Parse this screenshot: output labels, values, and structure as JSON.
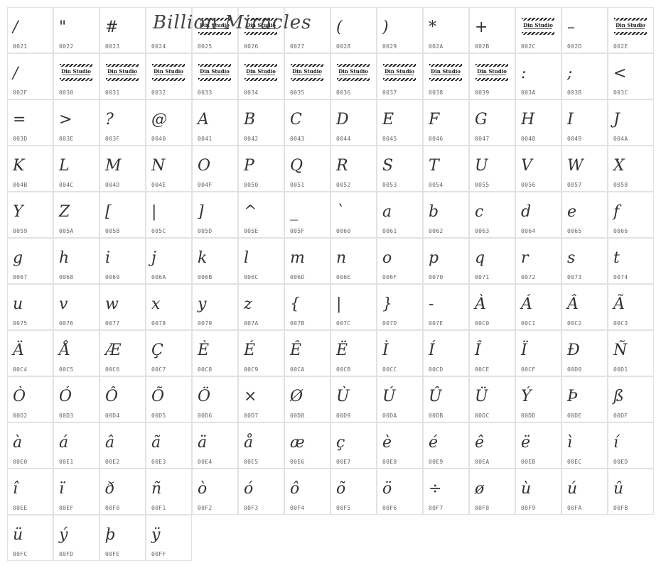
{
  "title": "Billion Miracles",
  "stamp_label": "Din Studio",
  "glyphs": [
    {
      "code": "0021",
      "char": "/"
    },
    {
      "code": "0022",
      "char": "\""
    },
    {
      "code": "0023",
      "char": "#"
    },
    {
      "code": "0024",
      "char": ""
    },
    {
      "code": "0025",
      "char": "",
      "stamp": true
    },
    {
      "code": "0026",
      "char": "",
      "stamp": true
    },
    {
      "code": "0027",
      "char": "'"
    },
    {
      "code": "0028",
      "char": "("
    },
    {
      "code": "0029",
      "char": ")"
    },
    {
      "code": "002A",
      "char": "*"
    },
    {
      "code": "002B",
      "char": "+"
    },
    {
      "code": "002C",
      "char": "",
      "stamp": true
    },
    {
      "code": "002D",
      "char": "–"
    },
    {
      "code": "002E",
      "char": "",
      "stamp": true
    },
    {
      "code": "002F",
      "char": "/"
    },
    {
      "code": "0030",
      "char": "",
      "stamp": true
    },
    {
      "code": "0031",
      "char": "",
      "stamp": true
    },
    {
      "code": "0032",
      "char": "",
      "stamp": true
    },
    {
      "code": "0033",
      "char": "",
      "stamp": true
    },
    {
      "code": "0034",
      "char": "",
      "stamp": true
    },
    {
      "code": "0035",
      "char": "",
      "stamp": true
    },
    {
      "code": "0036",
      "char": "",
      "stamp": true
    },
    {
      "code": "0037",
      "char": "",
      "stamp": true
    },
    {
      "code": "0038",
      "char": "",
      "stamp": true
    },
    {
      "code": "0039",
      "char": "",
      "stamp": true
    },
    {
      "code": "003A",
      "char": ":"
    },
    {
      "code": "003B",
      "char": ";"
    },
    {
      "code": "003C",
      "char": "<"
    },
    {
      "code": "003D",
      "char": "="
    },
    {
      "code": "003E",
      "char": ">"
    },
    {
      "code": "003F",
      "char": "?"
    },
    {
      "code": "0040",
      "char": "@"
    },
    {
      "code": "0041",
      "char": "A"
    },
    {
      "code": "0042",
      "char": "B"
    },
    {
      "code": "0043",
      "char": "C"
    },
    {
      "code": "0044",
      "char": "D"
    },
    {
      "code": "0045",
      "char": "E"
    },
    {
      "code": "0046",
      "char": "F"
    },
    {
      "code": "0047",
      "char": "G"
    },
    {
      "code": "0048",
      "char": "H"
    },
    {
      "code": "0049",
      "char": "I"
    },
    {
      "code": "004A",
      "char": "J"
    },
    {
      "code": "004B",
      "char": "K"
    },
    {
      "code": "004C",
      "char": "L"
    },
    {
      "code": "004D",
      "char": "M"
    },
    {
      "code": "004E",
      "char": "N"
    },
    {
      "code": "004F",
      "char": "O"
    },
    {
      "code": "0050",
      "char": "P"
    },
    {
      "code": "0051",
      "char": "Q"
    },
    {
      "code": "0052",
      "char": "R"
    },
    {
      "code": "0053",
      "char": "S"
    },
    {
      "code": "0054",
      "char": "T"
    },
    {
      "code": "0055",
      "char": "U"
    },
    {
      "code": "0056",
      "char": "V"
    },
    {
      "code": "0057",
      "char": "W"
    },
    {
      "code": "0058",
      "char": "X"
    },
    {
      "code": "0059",
      "char": "Y"
    },
    {
      "code": "005A",
      "char": "Z"
    },
    {
      "code": "005B",
      "char": "["
    },
    {
      "code": "005C",
      "char": "|"
    },
    {
      "code": "005D",
      "char": "]"
    },
    {
      "code": "005E",
      "char": "^"
    },
    {
      "code": "005F",
      "char": "_"
    },
    {
      "code": "0060",
      "char": "`"
    },
    {
      "code": "0061",
      "char": "a"
    },
    {
      "code": "0062",
      "char": "b"
    },
    {
      "code": "0063",
      "char": "c"
    },
    {
      "code": "0064",
      "char": "d"
    },
    {
      "code": "0065",
      "char": "e"
    },
    {
      "code": "0066",
      "char": "f"
    },
    {
      "code": "0067",
      "char": "g"
    },
    {
      "code": "0068",
      "char": "h"
    },
    {
      "code": "0069",
      "char": "i"
    },
    {
      "code": "006A",
      "char": "j"
    },
    {
      "code": "006B",
      "char": "k"
    },
    {
      "code": "006C",
      "char": "l"
    },
    {
      "code": "006D",
      "char": "m"
    },
    {
      "code": "006E",
      "char": "n"
    },
    {
      "code": "006F",
      "char": "o"
    },
    {
      "code": "0070",
      "char": "p"
    },
    {
      "code": "0071",
      "char": "q"
    },
    {
      "code": "0072",
      "char": "r"
    },
    {
      "code": "0073",
      "char": "s"
    },
    {
      "code": "0074",
      "char": "t"
    },
    {
      "code": "0075",
      "char": "u"
    },
    {
      "code": "0076",
      "char": "v"
    },
    {
      "code": "0077",
      "char": "w"
    },
    {
      "code": "0078",
      "char": "x"
    },
    {
      "code": "0079",
      "char": "y"
    },
    {
      "code": "007A",
      "char": "z"
    },
    {
      "code": "007B",
      "char": "{"
    },
    {
      "code": "007C",
      "char": "|"
    },
    {
      "code": "007D",
      "char": "}"
    },
    {
      "code": "007E",
      "char": "-"
    },
    {
      "code": "00C0",
      "char": "À"
    },
    {
      "code": "00C1",
      "char": "Á"
    },
    {
      "code": "00C2",
      "char": "Â"
    },
    {
      "code": "00C3",
      "char": "Ã"
    },
    {
      "code": "00C4",
      "char": "Ä"
    },
    {
      "code": "00C5",
      "char": "Å"
    },
    {
      "code": "00C6",
      "char": "Æ"
    },
    {
      "code": "00C7",
      "char": "Ç"
    },
    {
      "code": "00C8",
      "char": "È"
    },
    {
      "code": "00C9",
      "char": "É"
    },
    {
      "code": "00CA",
      "char": "Ê"
    },
    {
      "code": "00CB",
      "char": "Ë"
    },
    {
      "code": "00CC",
      "char": "Ì"
    },
    {
      "code": "00CD",
      "char": "Í"
    },
    {
      "code": "00CE",
      "char": "Î"
    },
    {
      "code": "00CF",
      "char": "Ï"
    },
    {
      "code": "00D0",
      "char": "Ð"
    },
    {
      "code": "00D1",
      "char": "Ñ"
    },
    {
      "code": "00D2",
      "char": "Ò"
    },
    {
      "code": "00D3",
      "char": "Ó"
    },
    {
      "code": "00D4",
      "char": "Ô"
    },
    {
      "code": "00D5",
      "char": "Õ"
    },
    {
      "code": "00D6",
      "char": "Ö"
    },
    {
      "code": "00D7",
      "char": "×"
    },
    {
      "code": "00D8",
      "char": "Ø"
    },
    {
      "code": "00D9",
      "char": "Ù"
    },
    {
      "code": "00DA",
      "char": "Ú"
    },
    {
      "code": "00DB",
      "char": "Û"
    },
    {
      "code": "00DC",
      "char": "Ü"
    },
    {
      "code": "00DD",
      "char": "Ý"
    },
    {
      "code": "00DE",
      "char": "Þ"
    },
    {
      "code": "00DF",
      "char": "ß"
    },
    {
      "code": "00E0",
      "char": "à"
    },
    {
      "code": "00E1",
      "char": "á"
    },
    {
      "code": "00E2",
      "char": "â"
    },
    {
      "code": "00E3",
      "char": "ã"
    },
    {
      "code": "00E4",
      "char": "ä"
    },
    {
      "code": "00E5",
      "char": "å"
    },
    {
      "code": "00E6",
      "char": "æ"
    },
    {
      "code": "00E7",
      "char": "ç"
    },
    {
      "code": "00E8",
      "char": "è"
    },
    {
      "code": "00E9",
      "char": "é"
    },
    {
      "code": "00EA",
      "char": "ê"
    },
    {
      "code": "00EB",
      "char": "ë"
    },
    {
      "code": "00EC",
      "char": "ì"
    },
    {
      "code": "00ED",
      "char": "í"
    },
    {
      "code": "00EE",
      "char": "î"
    },
    {
      "code": "00EF",
      "char": "ï"
    },
    {
      "code": "00F0",
      "char": "ð"
    },
    {
      "code": "00F1",
      "char": "ñ"
    },
    {
      "code": "00F2",
      "char": "ò"
    },
    {
      "code": "00F3",
      "char": "ó"
    },
    {
      "code": "00F4",
      "char": "ô"
    },
    {
      "code": "00F5",
      "char": "õ"
    },
    {
      "code": "00F6",
      "char": "ö"
    },
    {
      "code": "00F7",
      "char": "÷"
    },
    {
      "code": "00F8",
      "char": "ø"
    },
    {
      "code": "00F9",
      "char": "ù"
    },
    {
      "code": "00FA",
      "char": "ú"
    },
    {
      "code": "00FB",
      "char": "û"
    },
    {
      "code": "00FC",
      "char": "ü"
    },
    {
      "code": "00FD",
      "char": "ý"
    },
    {
      "code": "00FE",
      "char": "þ"
    },
    {
      "code": "00FF",
      "char": "ÿ"
    }
  ]
}
